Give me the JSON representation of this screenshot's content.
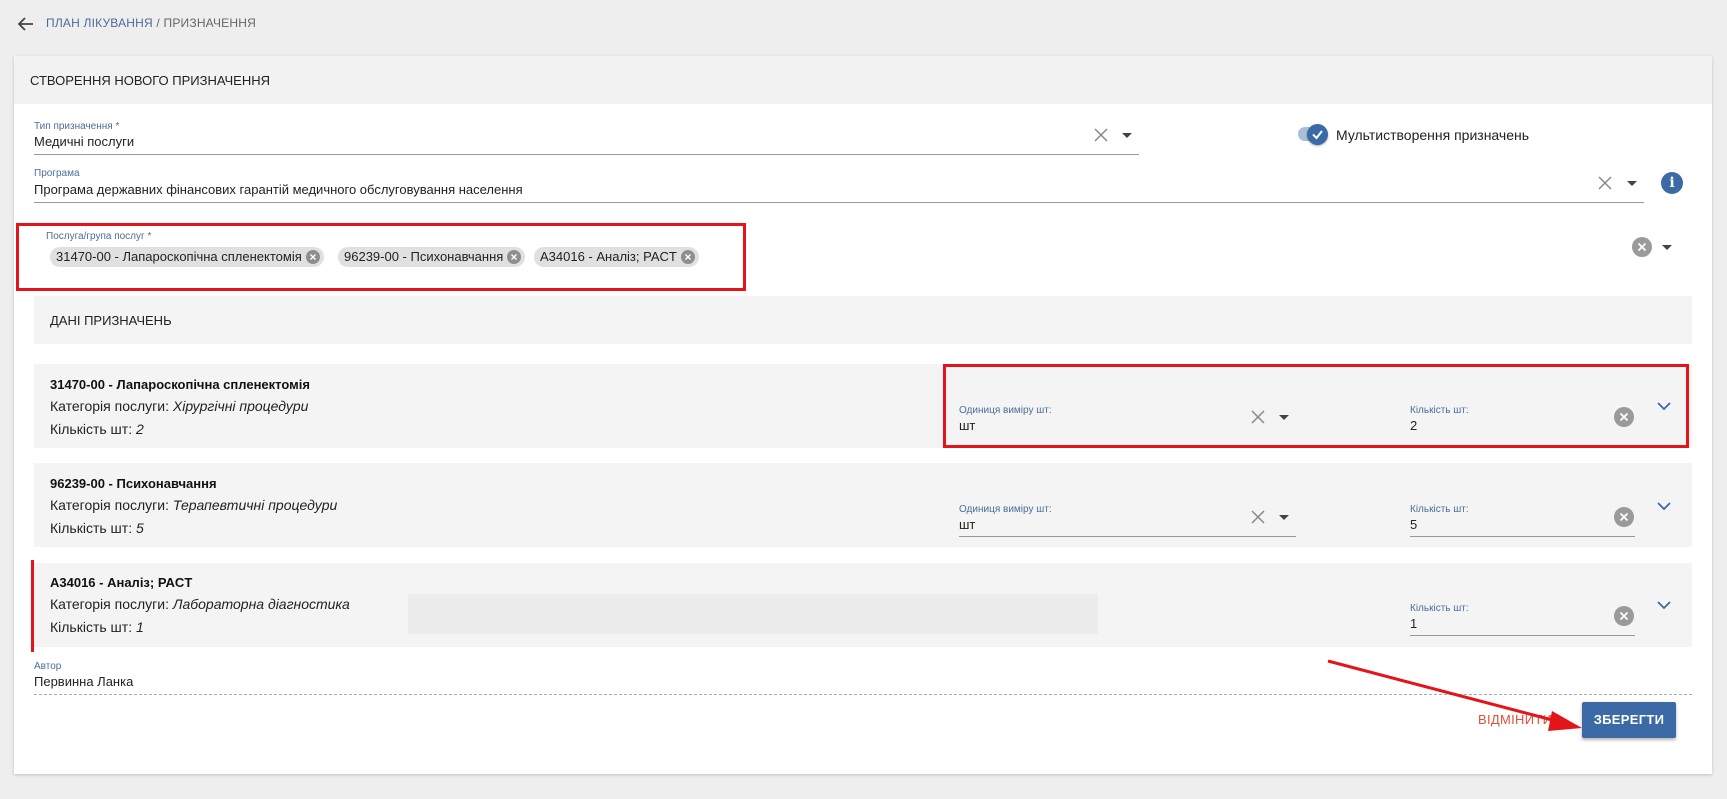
{
  "breadcrumb": {
    "parent": "ПЛАН ЛІКУВАННЯ",
    "separator": "/",
    "current": "ПРИЗНАЧЕННЯ"
  },
  "card": {
    "title": "СТВОРЕННЯ НОВОГО ПРИЗНАЧЕННЯ"
  },
  "type_field": {
    "label": "Тип призначення *",
    "value": "Медичні послуги"
  },
  "multi_toggle": {
    "label": "Мультистворення призначень",
    "checked": true
  },
  "program_field": {
    "label": "Програма",
    "value": "Програма державних фінансових гарантій медичного обслуговування населення"
  },
  "service_field": {
    "label": "Послуга/група послуг *",
    "chips": [
      "31470-00 - Лапароскопічна спленектомія",
      "96239-00 - Психонавчання",
      "A34016 - Аналіз; PACT"
    ]
  },
  "section": {
    "title": "ДАНІ ПРИЗНАЧЕНЬ"
  },
  "rows": [
    {
      "title": "31470-00 - Лапароскопічна спленектомія",
      "category_label": "Категорія послуги:",
      "category": "Хірургічні процедури",
      "qty_label": "Кількість шт:",
      "qty": "2",
      "unit_label": "Одиниця виміру шт:",
      "unit_value": "шт",
      "qty_field_label": "Кількість шт:",
      "qty_field_value": "2"
    },
    {
      "title": "96239-00 - Психонавчання",
      "category_label": "Категорія послуги:",
      "category": "Терапевтичні процедури",
      "qty_label": "Кількість шт:",
      "qty": "5",
      "unit_label": "Одиниця виміру шт:",
      "unit_value": "шт",
      "qty_field_label": "Кількість шт:",
      "qty_field_value": "5"
    },
    {
      "title": "A34016 - Аналіз; PACT",
      "category_label": "Категорія послуги:",
      "category": "Лабораторна діагностика",
      "qty_label": "Кількість шт:",
      "qty": "1",
      "qty_field_label": "Кількість шт:",
      "qty_field_value": "1"
    }
  ],
  "author": {
    "label": "Автор",
    "value": "Первинна Ланка"
  },
  "buttons": {
    "cancel": "ВІДМІНИТИ",
    "save": "ЗБЕРЕГТИ"
  },
  "colors": {
    "accent": "#3b6aa6",
    "highlight": "#e4141b",
    "cancel": "#e0503a"
  }
}
